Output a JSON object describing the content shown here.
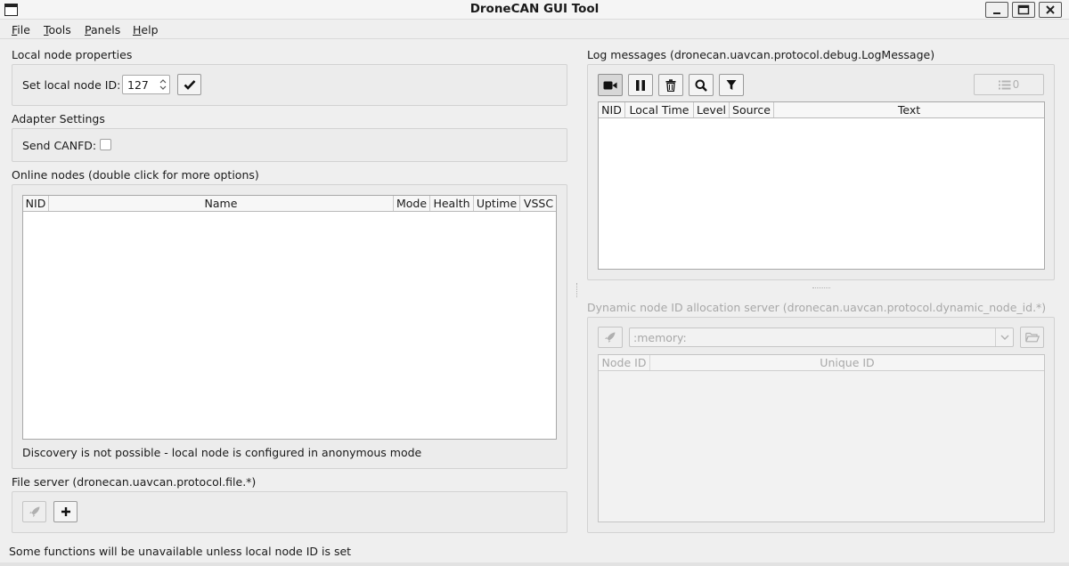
{
  "window": {
    "title": "DroneCAN GUI Tool"
  },
  "menu": [
    {
      "label": "File",
      "underline": "F",
      "rest": "ile"
    },
    {
      "label": "Tools",
      "underline": "T",
      "rest": "ools"
    },
    {
      "label": "Panels",
      "underline": "P",
      "rest": "anels"
    },
    {
      "label": "Help",
      "underline": "H",
      "rest": "elp"
    }
  ],
  "local_node": {
    "section_title": "Local node properties",
    "id_label": "Set local node ID:",
    "id_value": "127"
  },
  "adapter": {
    "section_title": "Adapter Settings",
    "canfd_label": "Send CANFD:",
    "canfd_checked": false
  },
  "online_nodes": {
    "section_title": "Online nodes (double click for more options)",
    "columns": [
      "NID",
      "Name",
      "Mode",
      "Health",
      "Uptime",
      "VSSC"
    ],
    "rows": [],
    "notice": "Discovery is not possible - local node is configured in anonymous mode"
  },
  "file_server": {
    "section_title": "File server (dronecan.uavcan.protocol.file.*)"
  },
  "log_messages": {
    "section_title": "Log messages (dronecan.uavcan.protocol.debug.LogMessage)",
    "count": "0",
    "columns": [
      "NID",
      "Local Time",
      "Level",
      "Source",
      "Text"
    ],
    "rows": []
  },
  "dynamic_node_id": {
    "section_title": "Dynamic node ID allocation server (dronecan.uavcan.protocol.dynamic_node_id.*)",
    "database": ":memory:",
    "columns": [
      "Node ID",
      "Unique ID"
    ],
    "rows": []
  },
  "status_bar": {
    "message": "Some functions will be unavailable unless local node ID is set"
  }
}
